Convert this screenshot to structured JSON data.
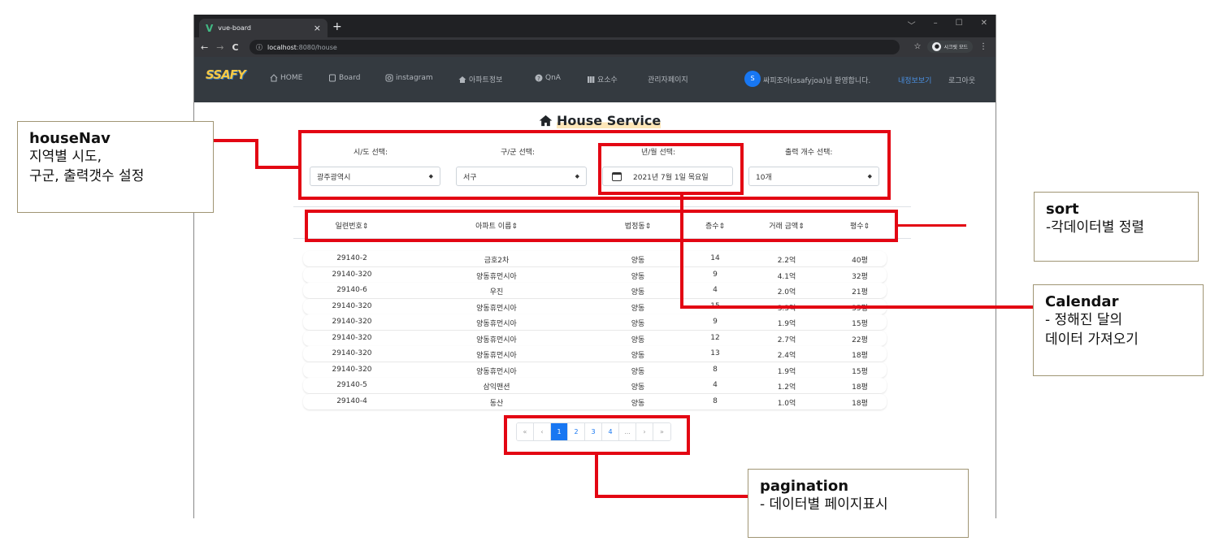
{
  "browser": {
    "tab_title": "vue-board",
    "tab_close": "×",
    "new_tab": "+",
    "url_host": "localhost",
    "url_path": ":8080/house",
    "nav_back": "←",
    "nav_forward": "→",
    "nav_reload": "C",
    "info": "ⓘ",
    "bookmark": "☆",
    "secret_mode": "시크릿 모드",
    "menu": "⋮",
    "win_controls": [
      "﹀",
      "–",
      "☐",
      "✕"
    ]
  },
  "app_nav": {
    "logo": "SSAFY",
    "items": [
      {
        "icon": "home-icon",
        "label": "HOME"
      },
      {
        "icon": "board-icon",
        "label": "Board"
      },
      {
        "icon": "instagram-icon",
        "label": "instagram"
      },
      {
        "icon": "house-icon",
        "label": "아파트정보"
      },
      {
        "icon": "question-icon",
        "label": "QnA"
      },
      {
        "icon": "columns-icon",
        "label": "요소수"
      },
      {
        "icon": "",
        "label": "관리자페이지"
      }
    ],
    "avatar_initial": "S",
    "welcome": "싸피조아(ssafyjoa)님 환영합니다.",
    "mypage": "내정보보기",
    "logout": "로그아웃"
  },
  "page": {
    "title": "House Service",
    "filters": [
      {
        "label": "시/도 선택:",
        "value": "광주광역시"
      },
      {
        "label": "구/군 선택:",
        "value": "서구"
      },
      {
        "label": "년/월 선택:",
        "value": "2021년 7월 1일 목요일"
      },
      {
        "label": "출력 개수 선택:",
        "value": "10개"
      }
    ],
    "columns": [
      "일련번호",
      "아파트 이름",
      "법정동",
      "층수",
      "거래 금액",
      "평수"
    ],
    "sort_glyph": "⇕",
    "rows": [
      [
        "29140-2",
        "금호2차",
        "양동",
        "14",
        "2.2억",
        "40평"
      ],
      [
        "29140-320",
        "양동휴먼시아",
        "양동",
        "9",
        "4.1억",
        "32평"
      ],
      [
        "29140-6",
        "우진",
        "양동",
        "4",
        "2.0억",
        "21평"
      ],
      [
        "29140-320",
        "양동휴먼시아",
        "양동",
        "15",
        "3.3억",
        "35평"
      ],
      [
        "29140-320",
        "양동휴먼시아",
        "양동",
        "9",
        "1.9억",
        "15평"
      ],
      [
        "29140-320",
        "양동휴먼시아",
        "양동",
        "12",
        "2.7억",
        "22평"
      ],
      [
        "29140-320",
        "양동휴먼시아",
        "양동",
        "13",
        "2.4억",
        "18평"
      ],
      [
        "29140-320",
        "양동휴먼시아",
        "양동",
        "8",
        "1.9억",
        "15평"
      ],
      [
        "29140-5",
        "삼익맨션",
        "양동",
        "4",
        "1.2억",
        "18평"
      ],
      [
        "29140-4",
        "동산",
        "양동",
        "8",
        "1.0억",
        "18평"
      ]
    ],
    "pagination": [
      "«",
      "‹",
      "1",
      "2",
      "3",
      "4",
      "...",
      "›",
      "»"
    ],
    "active_page": "1"
  },
  "annotations": {
    "houseNav": {
      "title": "houseNav",
      "desc": "지역별 시도,\n구군, 출력갯수 설정"
    },
    "sort": {
      "title": "sort",
      "desc": "-각데이터별 정렬"
    },
    "calendar": {
      "title": "Calendar",
      "desc": "- 정해진 달의\n데이터 가져오기"
    },
    "pagination": {
      "title": "pagination",
      "desc": "- 데이터별 페이지표시"
    },
    "accent_color": "#e30613"
  }
}
